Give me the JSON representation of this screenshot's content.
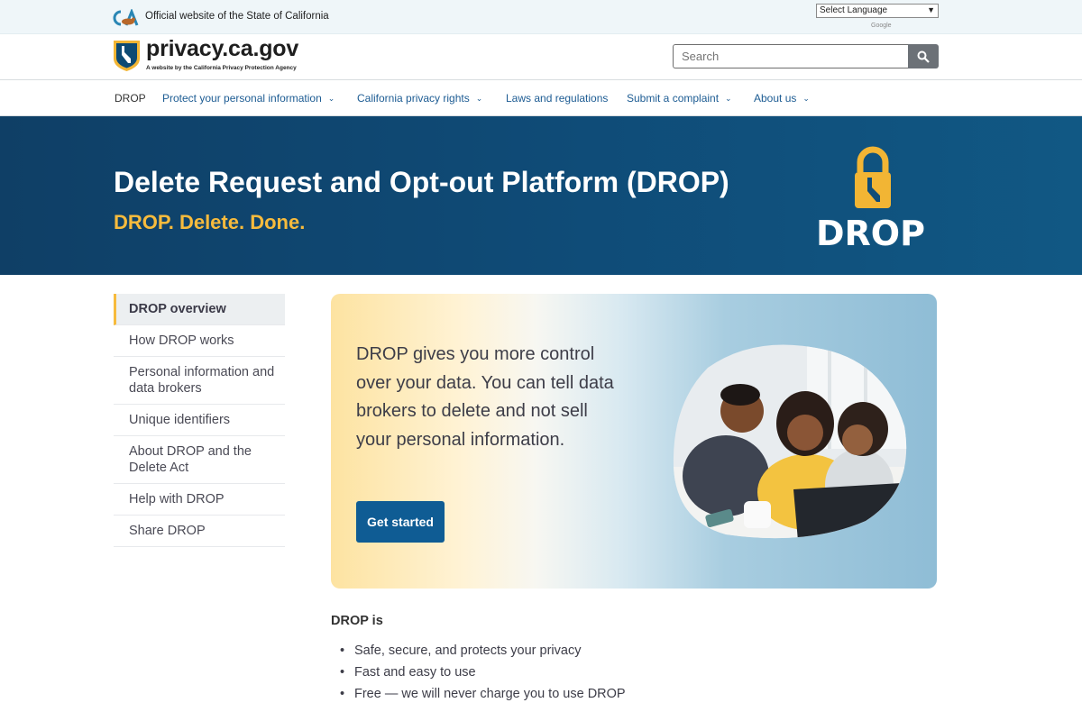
{
  "utility": {
    "official_text": "Official website of the State of California",
    "language_select": "Select Language",
    "google_label": "Google"
  },
  "branding": {
    "site_name": "privacy.ca.gov",
    "tagline": "A website by the California Privacy Protection Agency"
  },
  "search": {
    "placeholder": "Search",
    "value": "Search"
  },
  "nav": {
    "items": [
      {
        "label": "DROP",
        "has_menu": false
      },
      {
        "label": "Protect your personal information",
        "has_menu": true
      },
      {
        "label": "California privacy rights",
        "has_menu": true
      },
      {
        "label": "Laws and regulations",
        "has_menu": false
      },
      {
        "label": "Submit a complaint",
        "has_menu": true
      },
      {
        "label": "About us",
        "has_menu": true
      }
    ]
  },
  "hero": {
    "title": "Delete Request and Opt-out Platform (DROP)",
    "tagline": "DROP. Delete. Done.",
    "logo_text": "DROP"
  },
  "sidebar": {
    "items": [
      {
        "label": "DROP overview",
        "active": true
      },
      {
        "label": "How DROP works"
      },
      {
        "label": "Personal information and data brokers"
      },
      {
        "label": "Unique identifiers"
      },
      {
        "label": "About DROP and the Delete Act"
      },
      {
        "label": "Help with DROP"
      },
      {
        "label": "Share DROP"
      }
    ]
  },
  "card": {
    "text": "DROP gives you more control over your data. You can tell data brokers to delete and not sell your personal information.",
    "button_label": "Get started"
  },
  "content": {
    "heading": "DROP is",
    "bullets": [
      "Safe, secure, and protects your privacy",
      "Fast and easy to use",
      "Free — we will never charge you to use DROP"
    ]
  },
  "colors": {
    "hero_bg": "#0f4c78",
    "accent_gold": "#f7bb3d",
    "link_blue": "#1d5c93",
    "button_blue": "#0f5c94"
  }
}
